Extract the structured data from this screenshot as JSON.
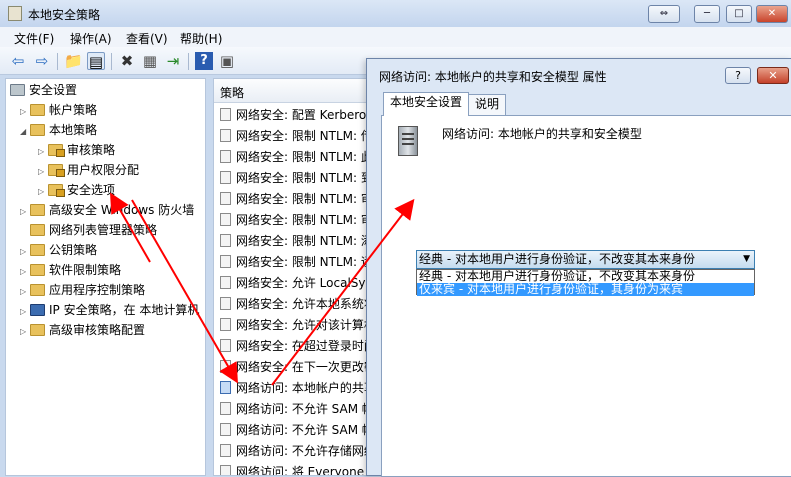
{
  "window": {
    "title": "本地安全策略",
    "restore_glyph": "⇔",
    "min_glyph": "─",
    "max_glyph": "□",
    "close_glyph": "✕"
  },
  "menu": [
    {
      "label": "文件(F)"
    },
    {
      "label": "操作(A)"
    },
    {
      "label": "查看(V)"
    },
    {
      "label": "帮助(H)"
    }
  ],
  "toolbar": [
    {
      "icon": "back-arrow-icon",
      "glyph": "⇦"
    },
    {
      "icon": "forward-arrow-icon",
      "glyph": "⇨"
    },
    {
      "icon": "up-folder-icon",
      "glyph": "📁"
    },
    {
      "icon": "show-hide-tree-icon",
      "glyph": "▤"
    },
    {
      "icon": "delete-icon",
      "glyph": "✖"
    },
    {
      "icon": "properties-icon",
      "glyph": "▦"
    },
    {
      "icon": "export-list-icon",
      "glyph": "⇥"
    },
    {
      "icon": "help-icon",
      "glyph": "?"
    },
    {
      "icon": "panel-icon",
      "glyph": "▣"
    }
  ],
  "tree": [
    {
      "label": "安全设置",
      "twisty": "",
      "icon": "security-settings-icon"
    },
    {
      "label": "帐户策略",
      "twisty": "▷",
      "icon": "folder-icon"
    },
    {
      "label": "本地策略",
      "twisty": "◢",
      "icon": "folder-icon"
    },
    {
      "label": "审核策略",
      "twisty": "▷",
      "icon": "locked-folder-icon"
    },
    {
      "label": "用户权限分配",
      "twisty": "▷",
      "icon": "locked-folder-icon"
    },
    {
      "label": "安全选项",
      "twisty": "▷",
      "icon": "locked-folder-icon"
    },
    {
      "label": "高级安全 Windows 防火墙",
      "twisty": "▷",
      "icon": "folder-icon"
    },
    {
      "label": "网络列表管理器策略",
      "twisty": "",
      "icon": "folder-icon"
    },
    {
      "label": "公钥策略",
      "twisty": "▷",
      "icon": "folder-icon"
    },
    {
      "label": "软件限制策略",
      "twisty": "▷",
      "icon": "folder-icon"
    },
    {
      "label": "应用程序控制策略",
      "twisty": "▷",
      "icon": "folder-icon"
    },
    {
      "label": "IP 安全策略，在 本地计算机",
      "twisty": "▷",
      "icon": "ip-policy-icon"
    },
    {
      "label": "高级审核策略配置",
      "twisty": "▷",
      "icon": "folder-icon"
    }
  ],
  "policy_list": {
    "header": "策略",
    "rows": [
      "网络安全: 配置 Kerberos",
      "网络安全: 限制 NTLM: 传",
      "网络安全: 限制 NTLM: 此",
      "网络安全: 限制 NTLM: 到",
      "网络安全: 限制 NTLM: 审",
      "网络安全: 限制 NTLM: 审",
      "网络安全: 限制 NTLM: 添",
      "网络安全: 限制 NTLM: 远",
      "网络安全: 允许 LocalSyst",
      "网络安全: 允许本地系统将",
      "网络安全: 允许对该计算机",
      "网络安全: 在超过登录时间",
      "网络安全: 在下一次更改密",
      "网络访问: 本地帐户的共享",
      "网络访问: 不允许 SAM 帐",
      "网络访问: 不允许 SAM 帐",
      "网络访问: 不允许存储网络",
      "网络访问: 将 Everyone 权"
    ]
  },
  "dialog": {
    "title": "网络访问: 本地帐户的共享和安全模型 属性",
    "help_glyph": "?",
    "close_glyph": "✕",
    "tabs": [
      {
        "label": "本地安全设置"
      },
      {
        "label": "说明"
      }
    ],
    "policy_title": "网络访问: 本地帐户的共享和安全模型",
    "combo_value": "经典 - 对本地用户进行身份验证，不改变其本来身份",
    "combo_arrow": "▼",
    "options": [
      "经典 - 对本地用户进行身份验证，不改变其本来身份",
      "仅来宾 - 对本地用户进行身份验证，其身份为来宾"
    ]
  },
  "colors": {
    "accent": "#3399ff",
    "arrow": "#ff0000"
  }
}
